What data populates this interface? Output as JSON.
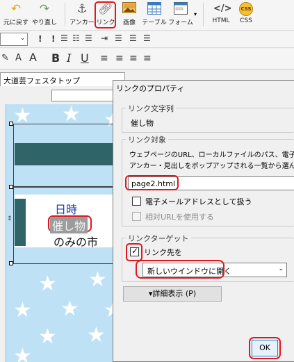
{
  "toolbar": {
    "undo_label": "元に戻す",
    "redo_label": "やり直し",
    "anchor_label": "アンカー",
    "link_label": "リンク",
    "image_label": "画像",
    "table_label": "テーブル",
    "form_label": "フォーム",
    "html_label": "HTML",
    "css_label": "CSS",
    "css_icon_text": "CSS",
    "html_icon_text": "</>"
  },
  "format_bar": {
    "bold": "B",
    "italic": "I",
    "underline": "U",
    "font_size_icons": [
      "A",
      "A"
    ]
  },
  "editor": {
    "tab_title": "大道芸フェスタトップ",
    "text_date": "日時",
    "text_event": "催し物",
    "text_market": "のみの市"
  },
  "dialog": {
    "title": "リンクのプロパティ",
    "link_text_group": "リンク文字列",
    "link_text_value": "催し物",
    "target_group": "リンク対象",
    "target_desc_line1": "ウェブページのURL、ローカルファイルのパス、電子メー",
    "target_desc_line2": "アンカー・見出しをポップアップされる一覧から選んで",
    "url_value": "page2.html",
    "email_checkbox_label": "電子メールアドレスとして扱う",
    "relative_url_label": "相対URLを使用する",
    "link_target_group": "リンクターゲット",
    "link_target_checkbox_label": "リンク先を",
    "link_target_select_value": "新しいウインドウに開く",
    "details_button": "▾詳細表示 (P)",
    "ok_button": "OK",
    "link_target_checked": true
  },
  "colors": {
    "annotation_red": "#e0171f",
    "teal": "#2f6468",
    "canvas_blue": "#bfe1f6",
    "link_blue": "#1a3fa6"
  }
}
